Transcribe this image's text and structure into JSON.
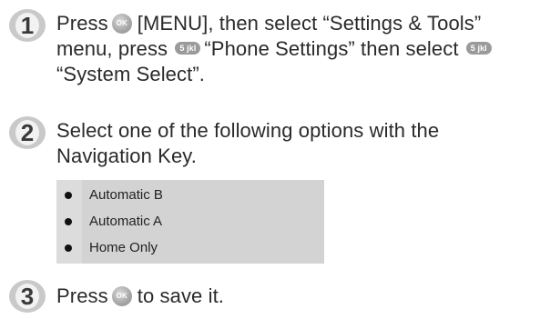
{
  "steps": [
    {
      "number": "1",
      "line1_pre": "Press",
      "ok_key_label": "OK",
      "line1_post": "[MENU], then select “Settings & Tools”",
      "line2_pre": "menu, press",
      "key5a_label": "5 jkl",
      "line2_mid": "“Phone Settings” then select",
      "key5b_label": "5 jkl",
      "line3": "“System Select”."
    },
    {
      "number": "2",
      "line1": "Select one of the following options with the",
      "line2": "Navigation Key."
    },
    {
      "number": "3",
      "pre": "Press",
      "ok_key_label": "OK",
      "post": "to save it."
    }
  ],
  "options": [
    {
      "label": "Automatic B"
    },
    {
      "label": "Automatic A"
    },
    {
      "label": "Home Only"
    }
  ],
  "icons": {
    "ok_key": "ok-key-icon",
    "key5": "key-5-icon",
    "bullet": "bullet-icon"
  },
  "colors": {
    "badge_fill": "#4a4a4a",
    "badge_light": "#bdbdbd",
    "option_panel": "#d3d3d3",
    "text": "#2a2a2a"
  }
}
